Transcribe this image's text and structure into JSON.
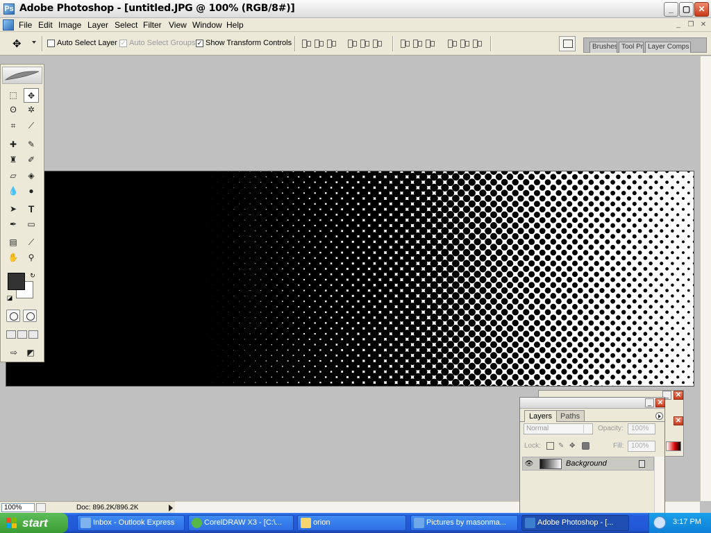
{
  "window": {
    "title": "Adobe Photoshop - [untitled.JPG @ 100% (RGB/8#)]",
    "controls": {
      "minimize": "_",
      "maximize": "▢",
      "close": "✕"
    }
  },
  "menu": {
    "items": [
      "File",
      "Edit",
      "Image",
      "Layer",
      "Select",
      "Filter",
      "View",
      "Window",
      "Help"
    ]
  },
  "options": {
    "auto_select_layer": "Auto Select Layer",
    "auto_select_groups": "Auto Select Groups",
    "show_transform_controls": "Show Transform Controls",
    "auto_select_layer_checked": false,
    "auto_select_groups_checked": true,
    "show_transform_controls_checked": true
  },
  "palette_well": {
    "tabs": [
      "Brushes",
      "Tool Pr",
      "Layer Comps"
    ]
  },
  "document": {
    "description_free": true,
    "gradient": "black-to-white halftone",
    "colors": {
      "ink": "#000000",
      "paper": "#ffffff"
    }
  },
  "toolbox": {
    "tools": [
      "rectangular-marquee",
      "move",
      "lasso",
      "magic-wand",
      "crop",
      "slice",
      "healing-brush",
      "brush",
      "clone-stamp",
      "history-brush",
      "eraser",
      "paint-bucket",
      "blur",
      "dodge",
      "path-selection",
      "type",
      "pen",
      "rectangle-shape",
      "notes",
      "eyedropper",
      "hand",
      "zoom"
    ],
    "foreground_color": "#333333",
    "background_color": "#ffffff"
  },
  "status": {
    "zoom": "100%",
    "doc_info": "Doc: 896.2K/896.2K"
  },
  "layers_panel": {
    "tabs": [
      "Layers",
      "Paths"
    ],
    "blend_mode": "Normal",
    "opacity_label": "Opacity:",
    "opacity_value": "100%",
    "lock_label": "Lock:",
    "fill_label": "Fill:",
    "fill_value": "100%",
    "layer_name": "Background"
  },
  "taskbar": {
    "start_label": "start",
    "tasks": [
      "Inbox - Outlook Express",
      "CorelDRAW X3 - [C:\\...",
      "orion",
      "Pictures by masonma...",
      "Adobe Photoshop - [..."
    ],
    "clock": "3:17 PM"
  }
}
